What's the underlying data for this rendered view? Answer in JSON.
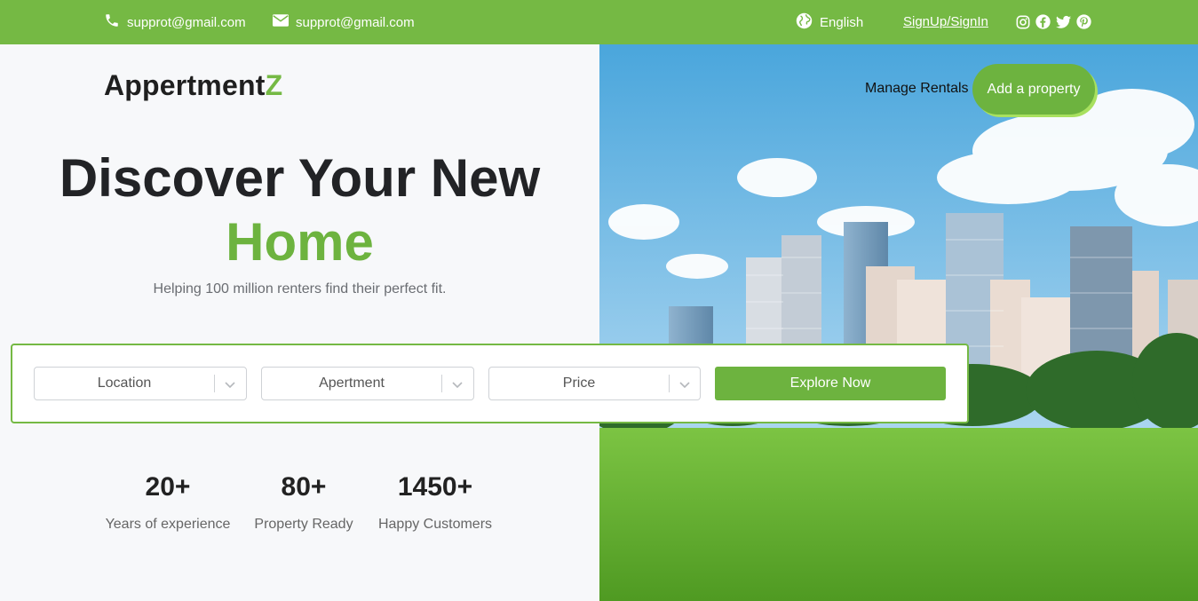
{
  "topbar": {
    "phone_email": "supprot@gmail.com",
    "mail_email": "supprot@gmail.com",
    "language": "English",
    "auth_link": "SignUp/SignIn",
    "social_icons": [
      "instagram-icon",
      "facebook-icon",
      "twitter-icon",
      "pinterest-icon"
    ]
  },
  "brand": {
    "name_main": "Appertment",
    "name_accent": "Z"
  },
  "nav": {
    "manage_rentals": "Manage Rentals",
    "add_property": "Add a property"
  },
  "hero": {
    "headline_line1": "Discover Your New",
    "headline_line2": "Home",
    "subtitle": "Helping 100 million renters find their perfect fit."
  },
  "search": {
    "location": "Location",
    "type": "Apertment",
    "price": "Price",
    "explore_button": "Explore Now"
  },
  "stats": [
    {
      "value": "20+",
      "label": "Years of experience"
    },
    {
      "value": "80+",
      "label": "Property Ready"
    },
    {
      "value": "1450+",
      "label": "Happy Customers"
    }
  ],
  "colors": {
    "accent": "#75b944",
    "accent_dark": "#6db33f",
    "text": "#222326"
  }
}
